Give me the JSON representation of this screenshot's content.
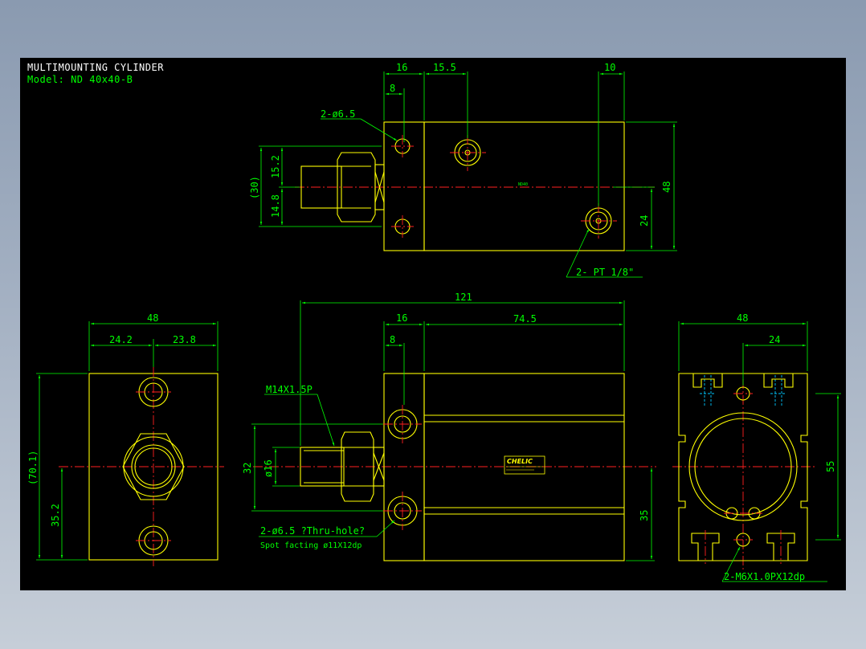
{
  "title": "MULTIMOUNTING CYLINDER",
  "model": "Model:  ND 40x40-B",
  "colors": {
    "background": "#000000",
    "outline": "#ffff00",
    "dimension": "#00ff00",
    "centerline": "#ff2020",
    "hidden": "#00c8ff",
    "title_text": "#ffffff",
    "model_text": "#00ff00",
    "window_bg": "#96a4b8"
  },
  "top_view": {
    "dim_16": "16",
    "dim_15_5": "15.5",
    "dim_10": "10",
    "dim_8": "8",
    "hole_callout": "2-ø6.5",
    "dim_30": "(30)",
    "dim_15_2": "15.2",
    "dim_14_8": "14.8",
    "dim_48": "48",
    "dim_24": "24",
    "port_callout": "2- PT 1/8\"",
    "body_mark": "ND40"
  },
  "left_view": {
    "dim_48": "48",
    "dim_24_2": "24.2",
    "dim_23_8": "23.8",
    "dim_70_1": "(70.1)",
    "dim_35_2": "35.2"
  },
  "front_view": {
    "dim_121": "121",
    "dim_16": "16",
    "dim_74_5": "74.5",
    "dim_8": "8",
    "thread_callout": "M14X1.5P",
    "dim_32": "32",
    "dim_dia16": "ø16",
    "dim_35": "35",
    "hole_note_1": "2-ø6.5 ?Thru-hole?",
    "hole_note_2": "Spot facting  ø11X12dp",
    "logo": "CHELIC"
  },
  "right_view": {
    "dim_48": "48",
    "dim_24": "24",
    "dim_55": "55",
    "tap_callout": "2-M6X1.0PX12dp"
  }
}
